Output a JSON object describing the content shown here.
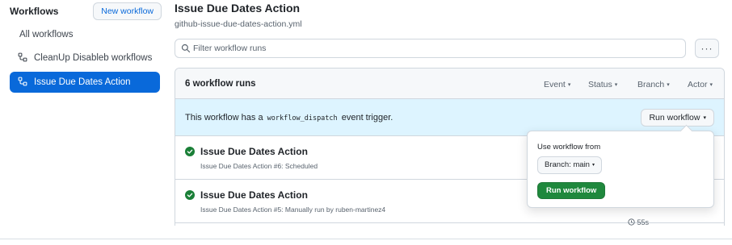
{
  "sidebar": {
    "title": "Workflows",
    "new_workflow_label": "New workflow",
    "items": [
      {
        "label": "All workflows",
        "icon": "none"
      },
      {
        "label": "CleanUp Disableb workflows",
        "icon": "workflow-icon"
      },
      {
        "label": "Issue Due Dates Action",
        "icon": "workflow-icon",
        "active": true
      }
    ]
  },
  "header": {
    "title": "Issue Due Dates Action",
    "file": "github-issue-due-dates-action.yml"
  },
  "filter": {
    "placeholder": "Filter workflow runs",
    "more_label": "···"
  },
  "runs": {
    "count_label": "6 workflow runs",
    "filters": [
      "Event",
      "Status",
      "Branch",
      "Actor"
    ],
    "dispatch": {
      "prefix": "This workflow has a",
      "code": "workflow_dispatch",
      "suffix": "event trigger.",
      "button_label": "Run workflow"
    },
    "items": [
      {
        "title": "Issue Due Dates Action",
        "subtitle": "Issue Due Dates Action #6: Scheduled",
        "status": "success"
      },
      {
        "title": "Issue Due Dates Action",
        "subtitle": "Issue Due Dates Action #5: Manually run by ruben-martinez4",
        "status": "success",
        "duration": "55s"
      }
    ]
  },
  "popover": {
    "label": "Use workflow from",
    "branch_label": "Branch: main",
    "run_label": "Run workflow"
  },
  "colors": {
    "accent": "#0969da",
    "success": "#1a7f37",
    "run_button": "#1f883d",
    "dispatch_bg": "#ddf4ff"
  }
}
